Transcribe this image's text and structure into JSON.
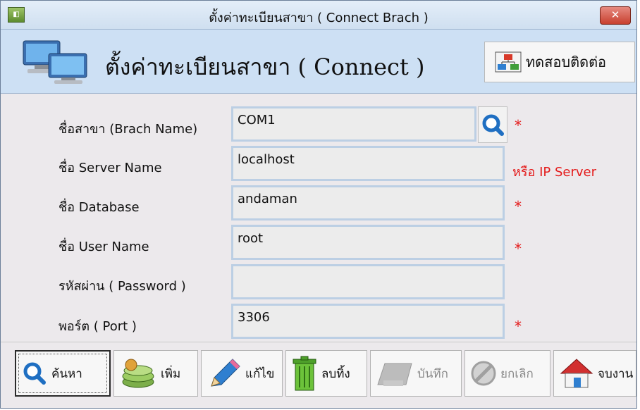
{
  "window": {
    "title": "ตั้งค่าทะเบียนสาขา ( Connect Brach )",
    "close_glyph": "✕"
  },
  "header": {
    "title": "ตั้งค่าทะเบียนสาขา ( Connect )",
    "test_button_label": "ทดสอบติดต่อ"
  },
  "form": {
    "branch_name": {
      "label": "ชื่อสาขา (Brach Name)",
      "value": "COM1",
      "required_mark": "*"
    },
    "server_name": {
      "label": "ชื่อ  Server Name",
      "value": "localhost",
      "hint": "หรือ IP Server"
    },
    "database": {
      "label": "ชื่อ Database",
      "value": "andaman",
      "required_mark": "*"
    },
    "user_name": {
      "label": "ชื่อ User Name",
      "value": "root",
      "required_mark": "*"
    },
    "password": {
      "label": "รหัสผ่าน ( Password )",
      "value": ""
    },
    "port": {
      "label": "พอร์ต ( Port )",
      "value": "3306",
      "required_mark": "*"
    }
  },
  "toolbar": {
    "search_label": "ค้นหา",
    "add_label": "เพิ่ม",
    "edit_label": "แก้ไข",
    "delete_label": "ลบทิ้ง",
    "save_label": "บันทึก",
    "cancel_label": "ยกเลิก",
    "exit_label": "จบงาน"
  },
  "colors": {
    "header_bg": "#cde0f4",
    "field_border": "#bccfe4",
    "required": "#e41b1b"
  }
}
